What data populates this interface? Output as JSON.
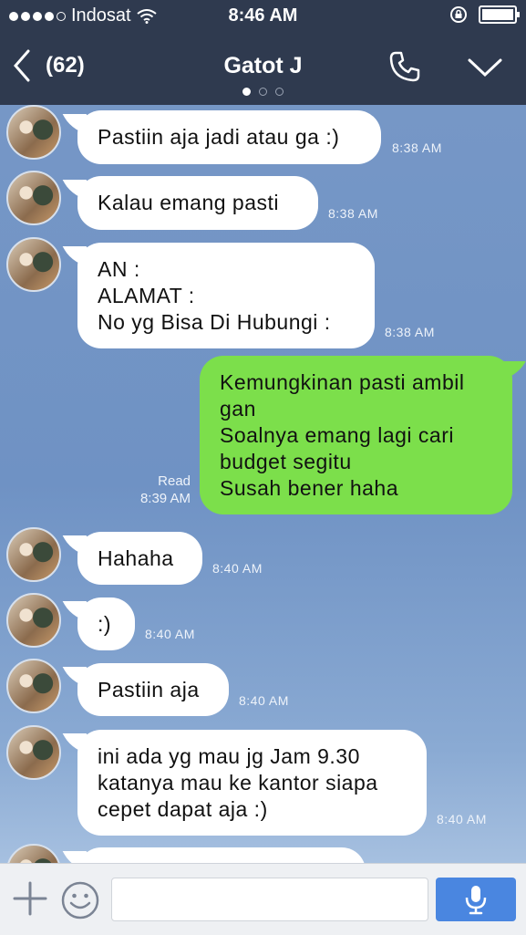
{
  "status_bar": {
    "carrier": "Indosat",
    "time": "8:46 AM"
  },
  "header": {
    "back_count": "(62)",
    "title": "Gatot J"
  },
  "messages": [
    {
      "side": "in",
      "lines": [
        "Pastiin aja jadi atau ga :)"
      ],
      "time": "8:38 AM"
    },
    {
      "side": "in",
      "lines": [
        "Kalau emang pasti"
      ],
      "time": "8:38 AM"
    },
    {
      "side": "in",
      "lines": [
        "AN :",
        "ALAMAT :",
        "No yg Bisa Di Hubungi :"
      ],
      "time": "8:38 AM"
    },
    {
      "side": "out",
      "lines": [
        "Kemungkinan pasti ambil",
        "gan",
        "Soalnya emang lagi cari",
        "budget segitu",
        "Susah bener haha"
      ],
      "read": "Read",
      "time": "8:39 AM"
    },
    {
      "side": "in",
      "lines": [
        "Hahaha"
      ],
      "time": "8:40 AM"
    },
    {
      "side": "in",
      "lines": [
        ":)"
      ],
      "time": "8:40 AM"
    },
    {
      "side": "in",
      "lines": [
        "Pastiin aja"
      ],
      "time": "8:40 AM"
    },
    {
      "side": "in",
      "lines": [
        "ini ada yg mau jg Jam 9.30",
        "katanya mau ke kantor siapa",
        "cepet dapat aja :)"
      ],
      "time": "8:40 AM"
    }
  ],
  "footer": {
    "input_value": ""
  },
  "colors": {
    "header_bg": "#2f3a4f",
    "chat_bg": "#6f92c6",
    "outgoing_bubble": "#7cdf4b",
    "mic_button": "#4a86e0"
  }
}
